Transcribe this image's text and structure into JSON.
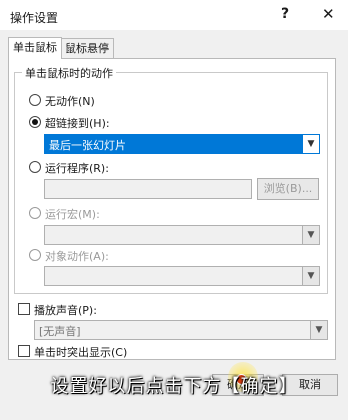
{
  "dialog": {
    "title": "操作设置",
    "help_label": "?",
    "close_label": "✕"
  },
  "tabs": [
    {
      "label": "单击鼠标",
      "active": true
    },
    {
      "label": "鼠标悬停",
      "active": false
    }
  ],
  "group": {
    "label": "单击鼠标时的动作",
    "options": [
      {
        "label": "无动作(N)",
        "selected": false,
        "enabled": true
      },
      {
        "label": "超链接到(H):",
        "selected": true,
        "enabled": true
      },
      {
        "label": "运行程序(R):",
        "selected": false,
        "enabled": true
      },
      {
        "label": "运行宏(M):",
        "selected": false,
        "enabled": false
      },
      {
        "label": "对象动作(A):",
        "selected": false,
        "enabled": false
      }
    ],
    "hyperlink_value": "最后一张幻灯片",
    "run_program_value": "",
    "browse_label": "浏览(B)...",
    "macro_value": "",
    "object_action_value": ""
  },
  "sound": {
    "label": "播放声音(P):",
    "value": "[无声音]",
    "checked": false
  },
  "highlight": {
    "label": "单击时突出显示(C)",
    "checked": false
  },
  "buttons": {
    "ok_label": "确定",
    "cancel_label": "取消"
  },
  "caption": "设置好以后点击下方【确定】",
  "colors": {
    "selection_blue": "#0078d7",
    "cursor_highlight": "#ffe650"
  }
}
